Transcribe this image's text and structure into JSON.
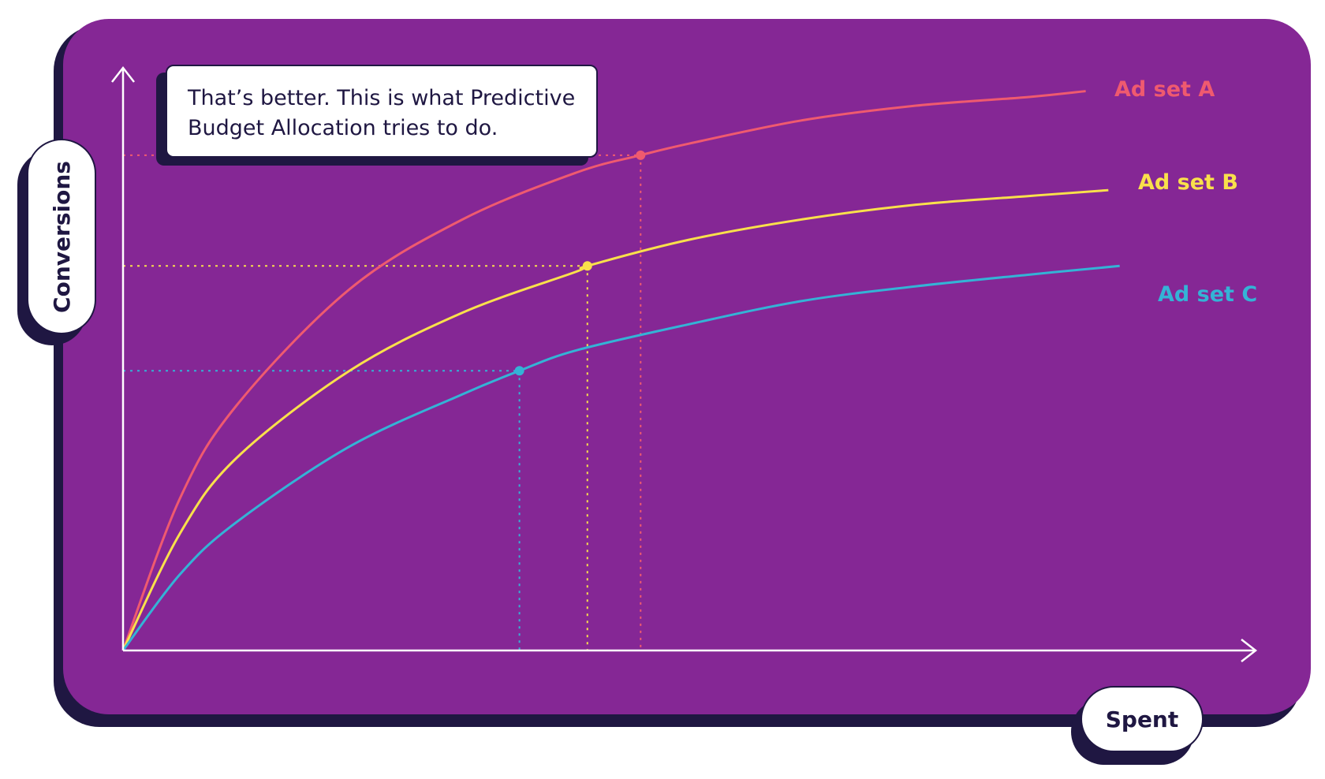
{
  "callout": {
    "line1": "That’s better. This is what Predictive",
    "line2": "Budget Allocation tries to do."
  },
  "colors": {
    "panel": "#852795",
    "outline": "#1f1742",
    "axis": "#ffffff"
  },
  "chart_data": {
    "type": "line",
    "title": "",
    "xlabel": "Spent",
    "ylabel": "Conversions",
    "xlim": [
      0,
      100
    ],
    "ylim": [
      0,
      100
    ],
    "grid": false,
    "series": [
      {
        "name": "Ad set A",
        "color": "#ef5a6f",
        "x": [
          0,
          5,
          10,
          20,
          30,
          40,
          45.7,
          50,
          60,
          70,
          80,
          85
        ],
        "y": [
          0,
          26,
          42,
          62,
          74,
          82,
          85,
          87,
          91,
          93.5,
          95,
          96
        ],
        "marker": {
          "x": 45.7,
          "y": 85
        }
      },
      {
        "name": "Ad set B",
        "color": "#f9e04b",
        "x": [
          0,
          5,
          10,
          20,
          30,
          40,
          41,
          50,
          60,
          70,
          80,
          87
        ],
        "y": [
          0,
          20,
          33,
          48,
          58,
          65,
          66,
          70.5,
          74,
          76.5,
          78,
          79
        ]
      },
      {
        "name": "Ad set C",
        "color": "#34b3d6",
        "x": [
          0,
          5,
          10,
          20,
          30,
          35,
          40,
          50,
          60,
          70,
          80,
          88
        ],
        "y": [
          0,
          13,
          22,
          35,
          44,
          48,
          51.5,
          56,
          60,
          62.5,
          64.5,
          66
        ]
      }
    ],
    "markers": [
      {
        "series": "Ad set A",
        "x": 45.7,
        "y": 85
      },
      {
        "series": "Ad set B",
        "x": 41,
        "y": 66
      },
      {
        "series": "Ad set C",
        "x": 35,
        "y": 48
      }
    ]
  }
}
